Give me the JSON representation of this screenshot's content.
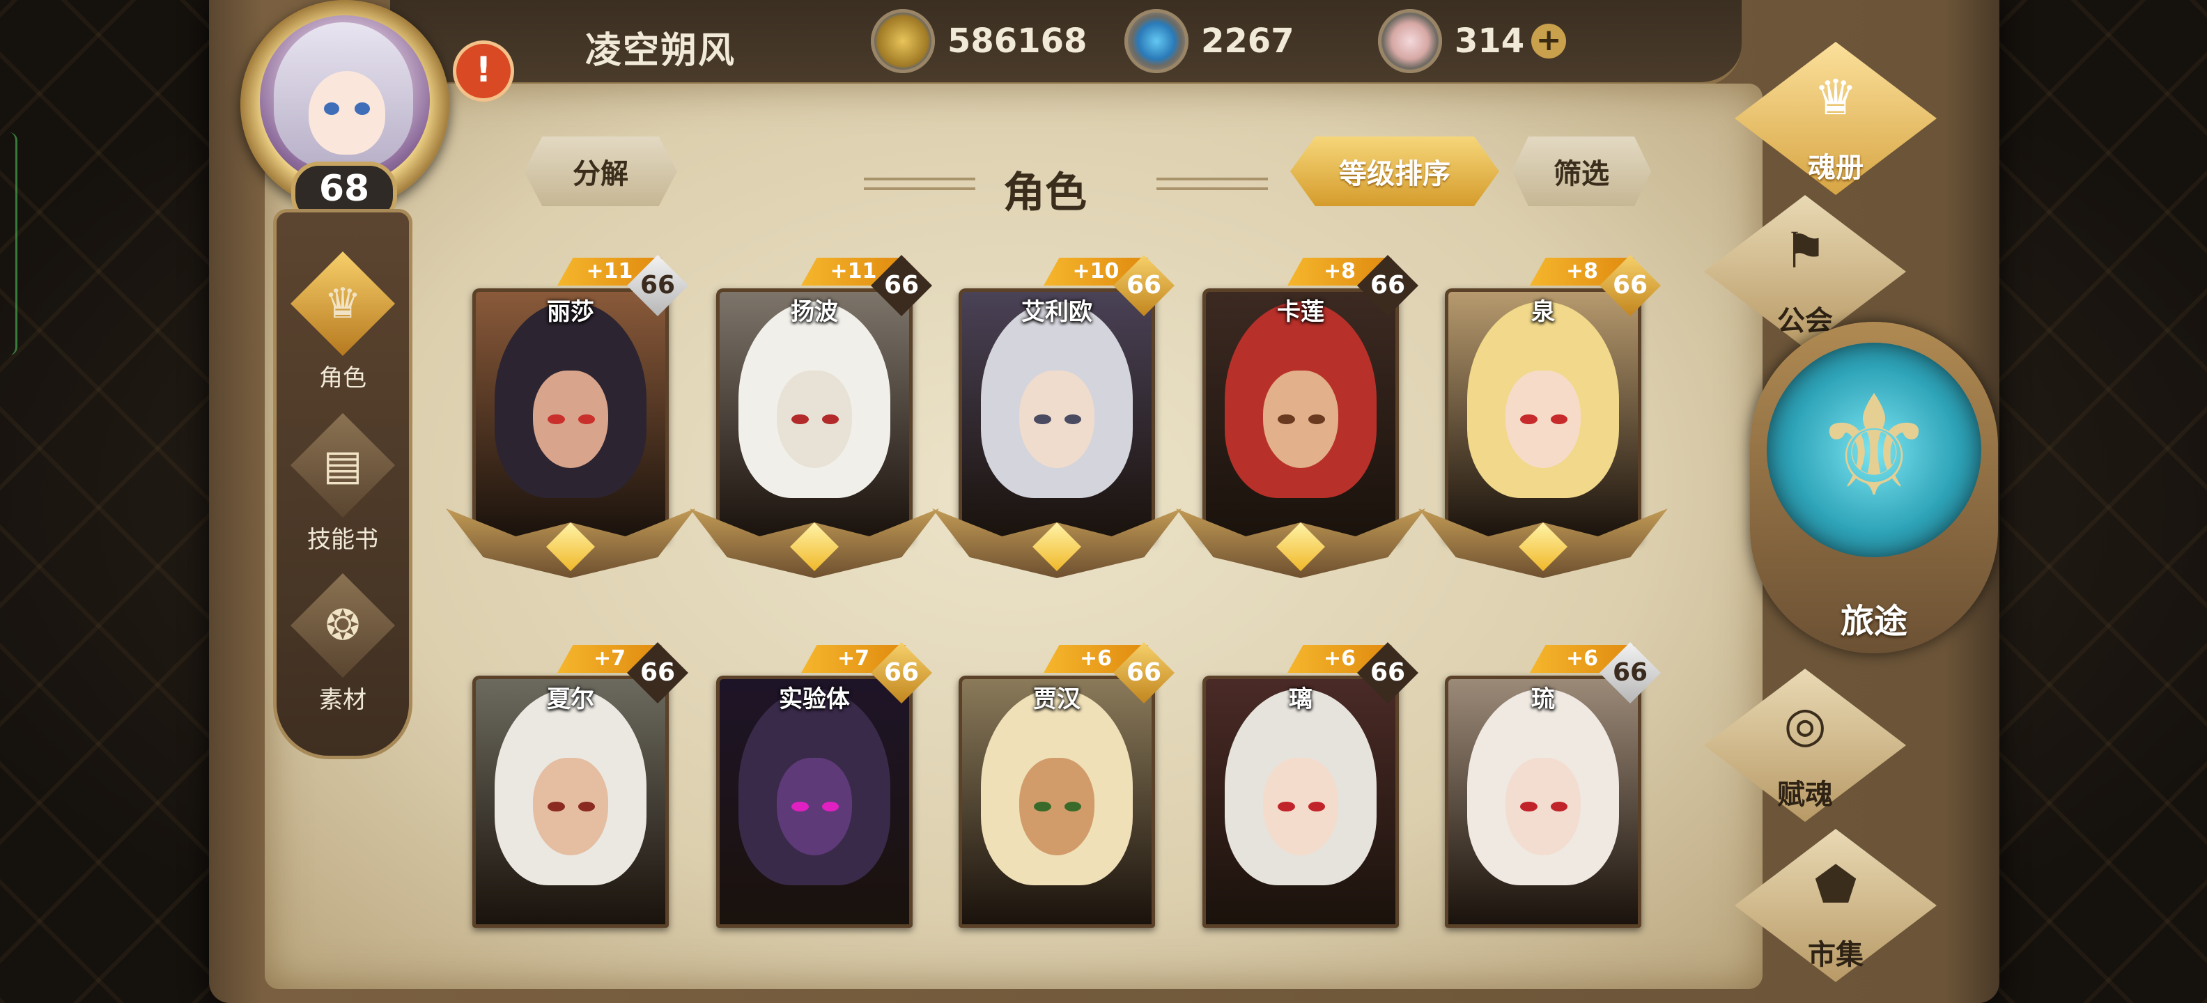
{
  "player": {
    "name": "凌空朔风",
    "level": "68",
    "alert": "!"
  },
  "resources": [
    {
      "icon": "gold-coin-icon",
      "value": "586168"
    },
    {
      "icon": "blue-crystal-icon",
      "value": "2267"
    },
    {
      "icon": "pink-gem-icon",
      "value": "314"
    }
  ],
  "resource_add": "+",
  "header": {
    "decompose": "分解",
    "title": "角色",
    "sort_level": "等级排序",
    "filter": "筛选"
  },
  "sidebar": [
    {
      "label": "角色",
      "icon": "character-icon",
      "active": true
    },
    {
      "label": "技能书",
      "icon": "skill-book-icon",
      "active": false
    },
    {
      "label": "素材",
      "icon": "material-icon",
      "active": false
    }
  ],
  "right_menu": {
    "soul_book": "魂册",
    "guild": "公会",
    "journey": "旅途",
    "endow_soul": "赋魂",
    "market": "市集"
  },
  "cards": [
    {
      "name": "丽莎",
      "plus": "+11",
      "level": "66",
      "badge": "silver",
      "hair": "#2c2430",
      "skin": "#d9a48c",
      "bg": "#8a5a3a",
      "eye": "#c9302c"
    },
    {
      "name": "扬波",
      "plus": "+11",
      "level": "66",
      "badge": "dark",
      "hair": "#f1efe9",
      "skin": "#e8e2d6",
      "bg": "#7d746a",
      "eye": "#b22a2a"
    },
    {
      "name": "艾利欧",
      "plus": "+10",
      "level": "66",
      "badge": "gold",
      "hair": "#d4d4dc",
      "skin": "#f0dccd",
      "bg": "#4a4256",
      "eye": "#4a4a60"
    },
    {
      "name": "卡莲",
      "plus": "+8",
      "level": "66",
      "badge": "dark",
      "hair": "#b8302a",
      "skin": "#e2b08a",
      "bg": "#3c2a22",
      "eye": "#6a3a20"
    },
    {
      "name": "泉",
      "plus": "+8",
      "level": "66",
      "badge": "gold",
      "hair": "#f1d88a",
      "skin": "#f6dcc8",
      "bg": "#b79a6e",
      "eye": "#c72a2a"
    },
    {
      "name": "夏尔",
      "plus": "+7",
      "level": "66",
      "badge": "dark",
      "hair": "#ebe8e2",
      "skin": "#e5bda0",
      "bg": "#6c6a5e",
      "eye": "#8a2a20"
    },
    {
      "name": "实验体",
      "plus": "+7",
      "level": "66",
      "badge": "gold",
      "hair": "#3a2a4a",
      "skin": "#5e3a78",
      "bg": "#1e1428",
      "eye": "#e020c0"
    },
    {
      "name": "贾汉",
      "plus": "+6",
      "level": "66",
      "badge": "gold",
      "hair": "#efe0b8",
      "skin": "#d29c6a",
      "bg": "#8a7a5a",
      "eye": "#3a6a2a"
    },
    {
      "name": "璃",
      "plus": "+6",
      "level": "66",
      "badge": "dark",
      "hair": "#e6e2dc",
      "skin": "#f4dccc",
      "bg": "#4a2a26",
      "eye": "#c0242a"
    },
    {
      "name": "琉",
      "plus": "+6",
      "level": "66",
      "badge": "silver",
      "hair": "#efe9e2",
      "skin": "#f3ddd0",
      "bg": "#9c8a78",
      "eye": "#c0242a"
    }
  ]
}
